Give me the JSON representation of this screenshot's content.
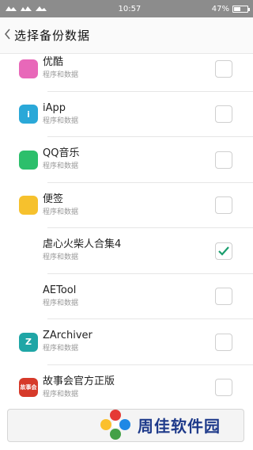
{
  "status_bar": {
    "time": "10:57",
    "battery": "47%",
    "battery_level": 0.47
  },
  "header": {
    "back_icon": "chevron-left-icon",
    "title": "选择备份数据"
  },
  "items": [
    {
      "name": "优酷",
      "subtitle": "程序和数据",
      "icon_label": "",
      "icon_color": "#e868b9",
      "checked": false
    },
    {
      "name": "iApp",
      "subtitle": "程序和数据",
      "icon_label": "i",
      "icon_color": "#2aa8d8",
      "checked": false
    },
    {
      "name": "QQ音乐",
      "subtitle": "程序和数据",
      "icon_label": "",
      "icon_color": "#2cbf6b",
      "checked": false
    },
    {
      "name": "便签",
      "subtitle": "程序和数据",
      "icon_label": "",
      "icon_color": "#f6c12d",
      "checked": false
    },
    {
      "name": "虐心火柴人合集4",
      "subtitle": "程序和数据",
      "icon_label": "",
      "icon_color": "#ffffff",
      "checked": true
    },
    {
      "name": "AETool",
      "subtitle": "程序和数据",
      "icon_label": "",
      "icon_color": "#ffffff",
      "checked": false
    },
    {
      "name": "ZArchiver",
      "subtitle": "程序和数据",
      "icon_label": "Z",
      "icon_color": "#1fa6a6",
      "checked": false
    },
    {
      "name": "故事会官方正版",
      "subtitle": "程序和数据",
      "icon_label": "故事会",
      "icon_color": "#d63a2a",
      "checked": false
    }
  ],
  "check_color": "#1a9e6e",
  "watermark": {
    "text": "周佳软件园"
  }
}
